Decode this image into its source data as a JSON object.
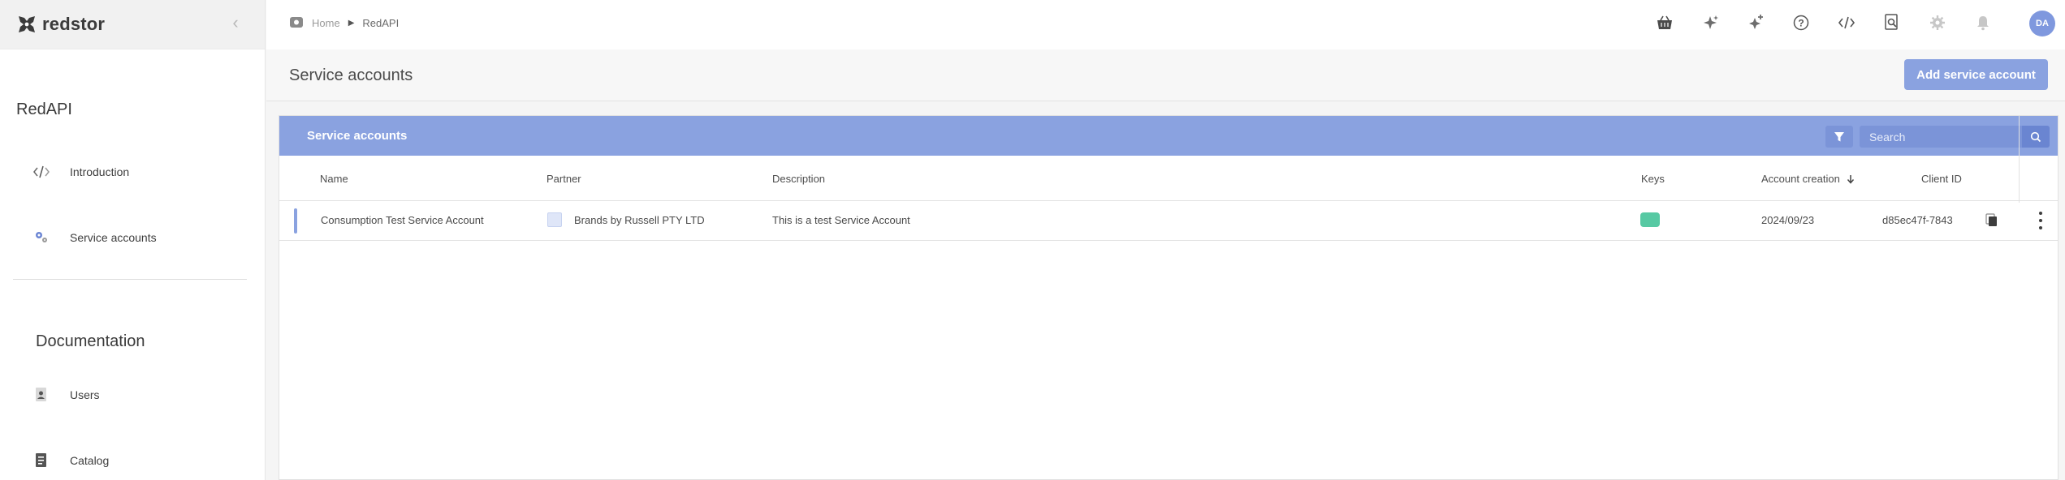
{
  "brand": {
    "name": "redstor"
  },
  "sidebar": {
    "product": "RedAPI",
    "items": [
      {
        "label": "Introduction",
        "icon": "code-icon"
      },
      {
        "label": "Service accounts",
        "icon": "gears-icon"
      }
    ],
    "documentation_title": "Documentation",
    "doc_items": [
      {
        "label": "Users",
        "icon": "user-doc-icon"
      },
      {
        "label": "Catalog",
        "icon": "catalog-doc-icon"
      }
    ]
  },
  "breadcrumb": {
    "home": "Home",
    "current": "RedAPI"
  },
  "topbar": {
    "icons": [
      "basket-icon",
      "sparkle-icon",
      "sparkle-plus-icon",
      "help-icon",
      "code-icon",
      "search-doc-icon",
      "gear-icon",
      "bell-icon"
    ],
    "avatar_initials": "DA"
  },
  "page": {
    "title": "Service accounts",
    "add_button": "Add service account"
  },
  "panel": {
    "title": "Service accounts",
    "search_placeholder": "Search",
    "columns": {
      "name": "Name",
      "partner": "Partner",
      "description": "Description",
      "keys": "Keys",
      "account_creation": "Account creation",
      "client_id": "Client ID"
    },
    "rows": [
      {
        "name": "Consumption Test Service Account",
        "partner": "Brands by Russell PTY LTD",
        "description": "This is a test Service Account",
        "account_creation": "2024/09/23",
        "client_id": "d85ec47f-7843"
      }
    ]
  },
  "colors": {
    "accent": "#8aa2e0",
    "key_badge": "#57c9a3",
    "avatar": "#7f98de"
  }
}
